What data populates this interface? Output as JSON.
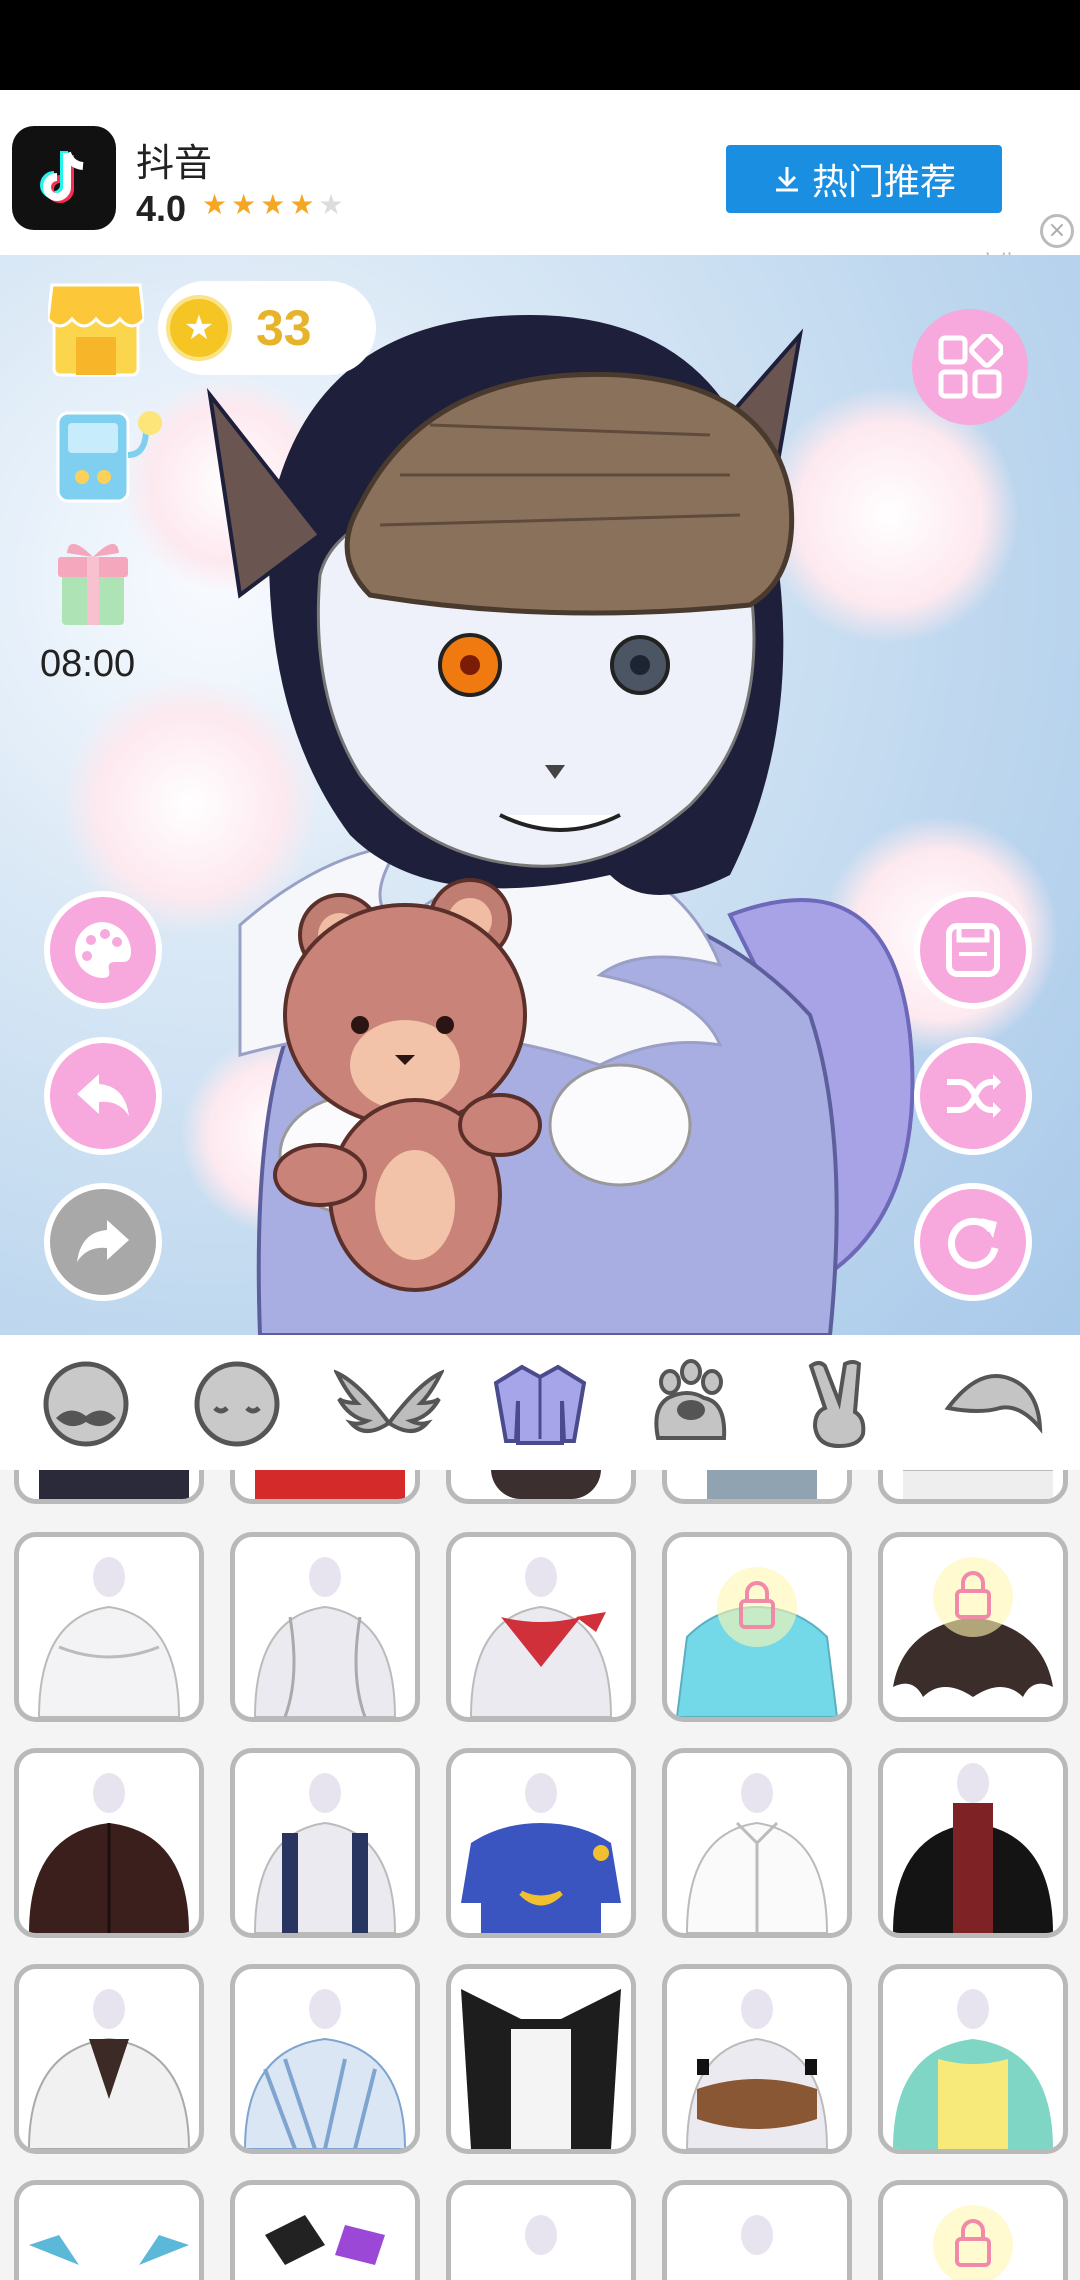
{
  "ad": {
    "app_name": "抖音",
    "rating": "4.0",
    "stars_filled": 4,
    "stars_total": 5,
    "button_label": "热门推荐",
    "tag": "广告"
  },
  "hud": {
    "coins": "33",
    "timer": "08:00"
  },
  "tabs": [
    "face-icon",
    "head-icon",
    "wings-icon",
    "shirt-icon",
    "paw-icon",
    "hand-icon",
    "tail-icon"
  ],
  "active_tab": 3,
  "outfits": [
    {
      "row": 1,
      "items": [
        "white-ruffle-top",
        "white-tank-top",
        "red-bandana",
        "blue-tshirt-locked",
        "dark-ruffle-top-locked"
      ]
    },
    {
      "row": 2,
      "items": [
        "dark-brown-jacket",
        "navy-suspenders",
        "blue-moon-tshirt",
        "white-shirt",
        "black-jacket-red-scarf"
      ]
    },
    {
      "row": 3,
      "items": [
        "white-cardigan",
        "striped-blue-jacket",
        "black-vampire-coat",
        "brown-crop-top",
        "teal-yellow-top"
      ]
    }
  ],
  "colors": {
    "accent_pink": "#f7a8dd",
    "coin_gold": "#e7b32a",
    "ad_blue": "#1a8ee1"
  }
}
